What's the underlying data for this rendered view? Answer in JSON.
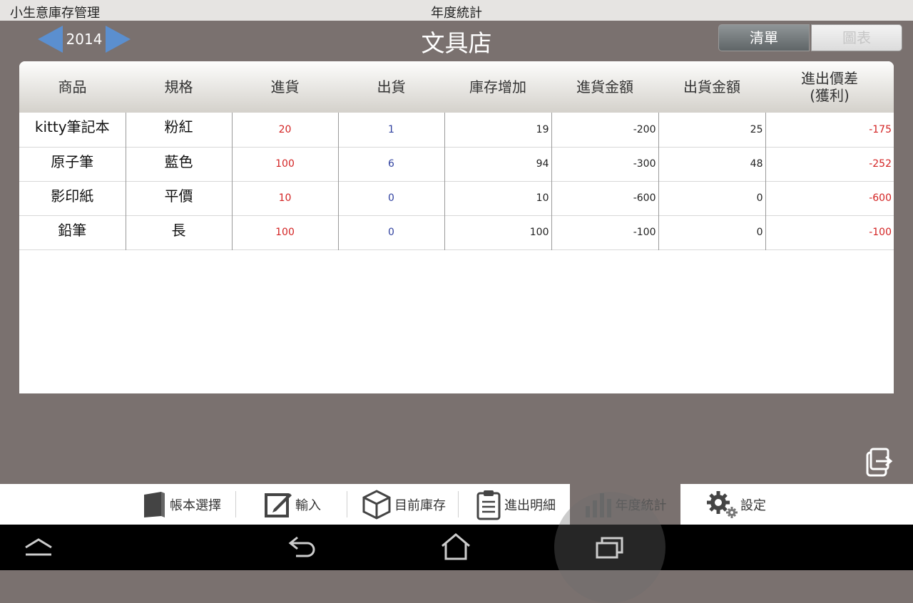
{
  "titlebar": {
    "app_name": "小生意庫存管理",
    "page_title": "年度統計"
  },
  "header": {
    "year": "2014",
    "shop_name": "文具店",
    "view_toggle": {
      "list": "清單",
      "chart": "圖表",
      "selected": "list"
    }
  },
  "table": {
    "columns": [
      "商品",
      "規格",
      "進貨",
      "出貨",
      "庫存增加",
      "進貨金額",
      "出貨金額",
      "進出價差",
      "(獲利)"
    ],
    "rows": [
      {
        "item": "kitty筆記本",
        "spec": "粉紅",
        "in": "20",
        "out": "1",
        "stock_increase": "19",
        "in_amount": "-200",
        "out_amount": "25",
        "profit": "-175"
      },
      {
        "item": "原子筆",
        "spec": "藍色",
        "in": "100",
        "out": "6",
        "stock_increase": "94",
        "in_amount": "-300",
        "out_amount": "48",
        "profit": "-252"
      },
      {
        "item": "影印紙",
        "spec": "平價",
        "in": "10",
        "out": "0",
        "stock_increase": "10",
        "in_amount": "-600",
        "out_amount": "0",
        "profit": "-600"
      },
      {
        "item": "鉛筆",
        "spec": "長",
        "in": "100",
        "out": "0",
        "stock_increase": "100",
        "in_amount": "-100",
        "out_amount": "0",
        "profit": "-100"
      }
    ]
  },
  "bottom_nav": [
    {
      "label": "帳本選擇",
      "icon": "book-icon"
    },
    {
      "label": "輸入",
      "icon": "edit-icon"
    },
    {
      "label": "目前庫存",
      "icon": "box-icon"
    },
    {
      "label": "進出明細",
      "icon": "clipboard-icon"
    },
    {
      "label": "年度統計",
      "icon": "bar-chart-icon",
      "active": true
    },
    {
      "label": "設定",
      "icon": "gear-icon"
    }
  ],
  "colors": {
    "background": "#7a716f",
    "accent_blue": "#5b8fcf",
    "in_red": "#d32323",
    "out_blue": "#3243a0"
  }
}
